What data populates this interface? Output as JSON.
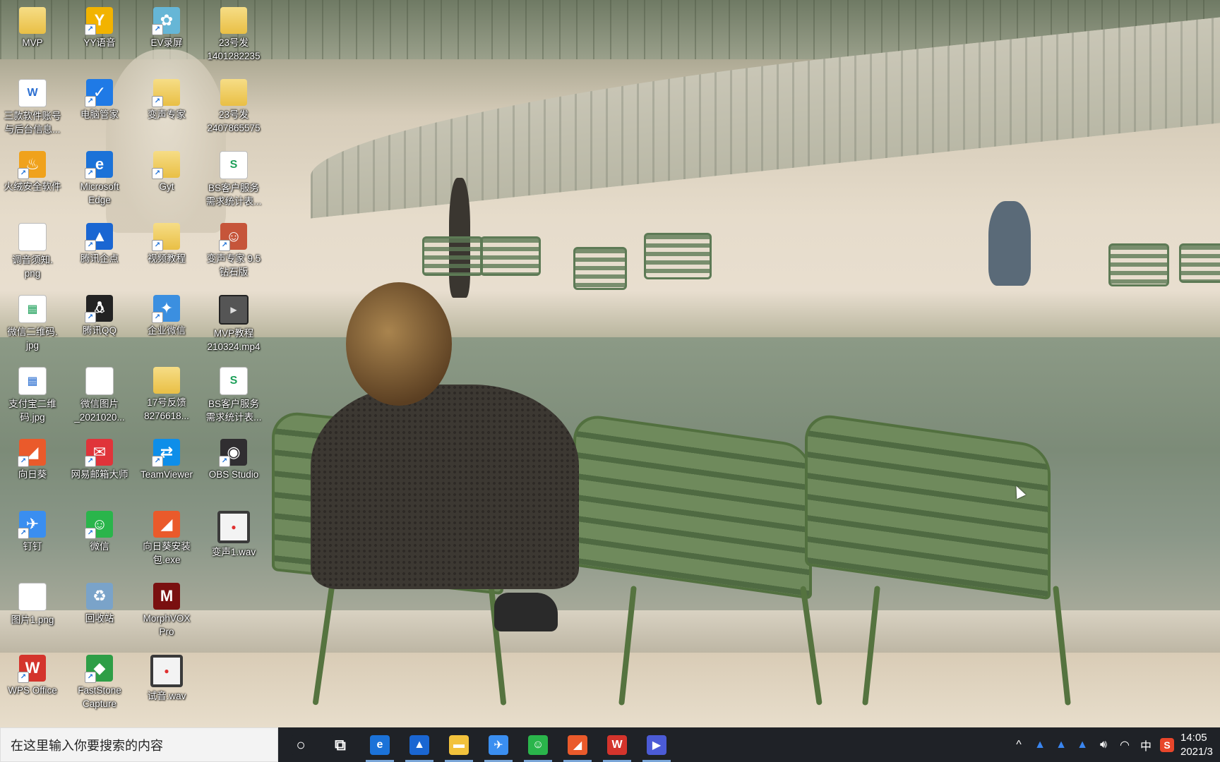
{
  "desktop": {
    "icons": [
      {
        "label": "MVP",
        "icon": "folder-icon",
        "shortcut": false
      },
      {
        "label": "YY语音",
        "icon": "yy-voice-icon",
        "shortcut": true
      },
      {
        "label": "EV录屏",
        "icon": "ev-recorder-icon",
        "shortcut": true
      },
      {
        "label": "23号发\n1401282235",
        "icon": "folder-icon",
        "shortcut": false
      },
      {
        "label": "三款软件账号\n与后台信息...",
        "icon": "word-document-icon",
        "shortcut": false
      },
      {
        "label": "电脑管家",
        "icon": "pc-manager-icon",
        "shortcut": true
      },
      {
        "label": "变声专家",
        "icon": "folder-icon",
        "shortcut": true
      },
      {
        "label": "23号发\n2407865575",
        "icon": "folder-icon",
        "shortcut": false
      },
      {
        "label": "火绒安全软件",
        "icon": "huorong-icon",
        "shortcut": true
      },
      {
        "label": "Microsoft\nEdge",
        "icon": "edge-icon",
        "shortcut": true
      },
      {
        "label": "Gyt",
        "icon": "folder-icon",
        "shortcut": true
      },
      {
        "label": "BS客户服务\n需求统计表...",
        "icon": "spreadsheet-icon",
        "shortcut": false
      },
      {
        "label": "调音须知.\npng",
        "icon": "image-file-icon",
        "shortcut": false
      },
      {
        "label": "腾讯企点",
        "icon": "tencent-qidian-icon",
        "shortcut": true
      },
      {
        "label": "视频教程",
        "icon": "folder-icon",
        "shortcut": true
      },
      {
        "label": "变声专家 9.5\n钻石版",
        "icon": "voice-changer-icon",
        "shortcut": true
      },
      {
        "label": "微信二维码.\njpg",
        "icon": "qr-image-icon",
        "shortcut": false
      },
      {
        "label": "腾讯QQ",
        "icon": "qq-icon",
        "shortcut": true
      },
      {
        "label": "企业微信",
        "icon": "wecom-icon",
        "shortcut": true
      },
      {
        "label": "MVP教程\n210324.mp4",
        "icon": "video-file-icon",
        "shortcut": false
      },
      {
        "label": "支付宝二维\n码.jpg",
        "icon": "alipay-qr-icon",
        "shortcut": false
      },
      {
        "label": "微信图片\n_2021020...",
        "icon": "image-file-icon",
        "shortcut": false
      },
      {
        "label": "17号反馈\n8276618...",
        "icon": "folder-icon",
        "shortcut": false
      },
      {
        "label": "BS客户服务\n需求统计表...",
        "icon": "spreadsheet-icon",
        "shortcut": false
      },
      {
        "label": "向日葵",
        "icon": "sunlogin-icon",
        "shortcut": true
      },
      {
        "label": "网易邮箱大师",
        "icon": "netease-mail-icon",
        "shortcut": true
      },
      {
        "label": "TeamViewer",
        "icon": "teamviewer-icon",
        "shortcut": true
      },
      {
        "label": "OBS Studio",
        "icon": "obs-icon",
        "shortcut": true
      },
      {
        "label": "钉钉",
        "icon": "dingtalk-icon",
        "shortcut": true
      },
      {
        "label": "微信",
        "icon": "wechat-icon",
        "shortcut": true
      },
      {
        "label": "向日葵安装\n包.exe",
        "icon": "sunlogin-installer-icon",
        "shortcut": false
      },
      {
        "label": "变声1.wav",
        "icon": "audio-file-icon",
        "shortcut": false
      },
      {
        "label": "图片1.png",
        "icon": "image-file-icon",
        "shortcut": false
      },
      {
        "label": "回收站",
        "icon": "recycle-bin-icon",
        "shortcut": false
      },
      {
        "label": "MorphVOX\nPro",
        "icon": "morphvox-icon",
        "shortcut": false
      },
      {
        "label": "WPS Office",
        "icon": "wps-icon",
        "shortcut": true
      },
      {
        "label": "FastStone\nCapture",
        "icon": "faststone-icon",
        "shortcut": true
      },
      {
        "label": "试音.wav",
        "icon": "audio-file-icon",
        "shortcut": false
      }
    ]
  },
  "taskbar": {
    "search_placeholder": "在这里输入你要搜索的内容",
    "apps": [
      {
        "name": "cortana-button",
        "glyph": "○",
        "color": "#1f2227",
        "running": false
      },
      {
        "name": "task-view-button",
        "glyph": "⧉",
        "color": "#1f2227",
        "running": false
      },
      {
        "name": "edge-taskbar",
        "glyph": "e",
        "color": "#1b72d8",
        "running": true
      },
      {
        "name": "tencent-qidian-taskbar",
        "glyph": "▲",
        "color": "#1a66d2",
        "running": true
      },
      {
        "name": "file-explorer-taskbar",
        "glyph": "▬",
        "color": "#f2c23c",
        "running": true
      },
      {
        "name": "dingtalk-taskbar",
        "glyph": "✈",
        "color": "#3a8ef0",
        "running": true
      },
      {
        "name": "wechat-taskbar",
        "glyph": "☺",
        "color": "#2ab54b",
        "running": true
      },
      {
        "name": "sunlogin-taskbar",
        "glyph": "◢",
        "color": "#ea5a2b",
        "running": true
      },
      {
        "name": "wps-taskbar",
        "glyph": "W",
        "color": "#d4342c",
        "running": true
      },
      {
        "name": "ev-recorder-taskbar",
        "glyph": "▶",
        "color": "#4b5bd6",
        "running": true
      }
    ],
    "tray": {
      "icons": [
        "chevron-up-icon",
        "qidian-tray-icon",
        "qidian-tray-icon",
        "qidian-tray-icon",
        "volume-icon",
        "network-icon"
      ],
      "ime": "中",
      "sogou": "S",
      "time": "14:05",
      "date": "2021/3"
    }
  }
}
